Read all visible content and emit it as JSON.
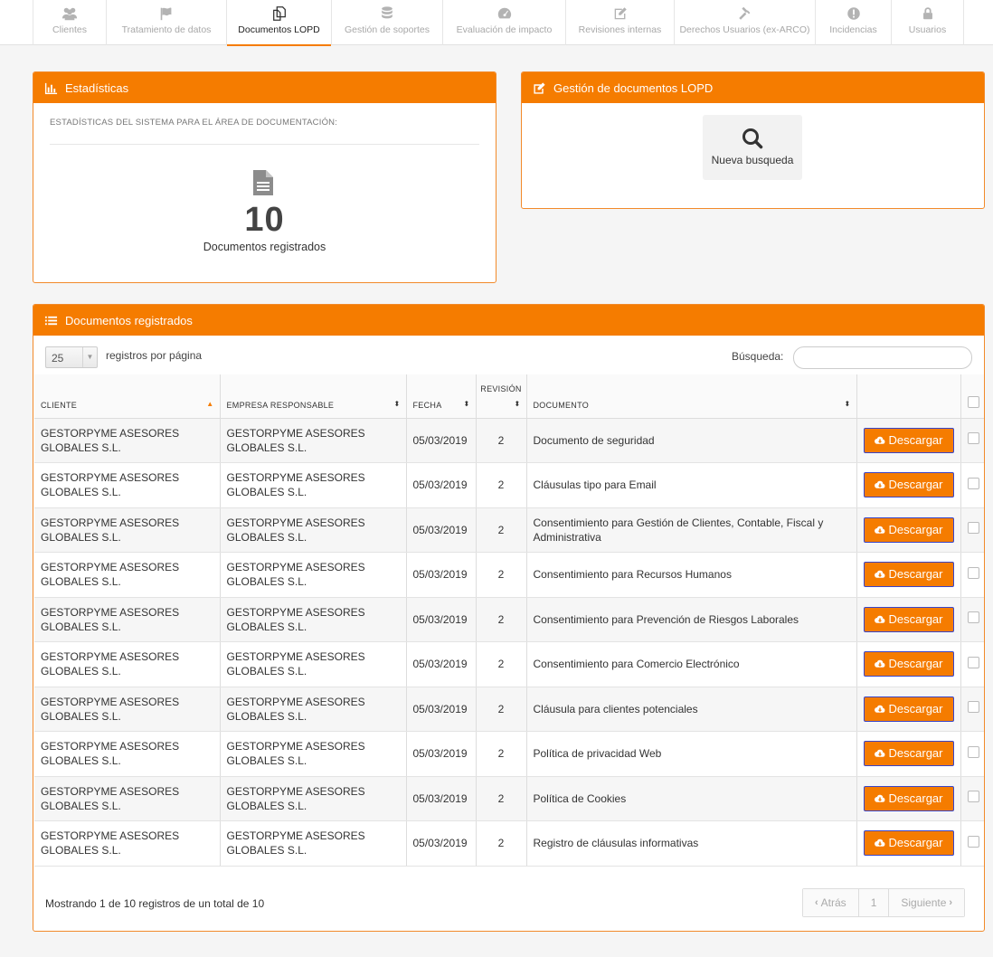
{
  "nav": {
    "tabs": [
      {
        "label": "Clientes",
        "icon": "users-icon"
      },
      {
        "label": "Tratamiento de datos",
        "icon": "flag-icon"
      },
      {
        "label": "Documentos LOPD",
        "icon": "copy-icon"
      },
      {
        "label": "Gestión de soportes",
        "icon": "database-icon"
      },
      {
        "label": "Evaluación de impacto",
        "icon": "dashboard-icon"
      },
      {
        "label": "Revisiones internas",
        "icon": "edit-icon"
      },
      {
        "label": "Derechos Usuarios (ex-ARCO)",
        "icon": "gavel-icon"
      },
      {
        "label": "Incidencias",
        "icon": "alert-icon"
      },
      {
        "label": "Usuarios",
        "icon": "lock-icon"
      }
    ],
    "active_index": 2
  },
  "stats": {
    "title": "Estadísticas",
    "caption": "Estadísticas del sistema para el área de documentación:",
    "count": "10",
    "count_label": "Documentos registrados"
  },
  "manage": {
    "title": "Gestión de documentos LOPD",
    "search_tile_label": "Nueva busqueda"
  },
  "table_panel": {
    "title": "Documentos registrados",
    "page_size": "25",
    "page_size_label": "registros por página",
    "search_label": "Búsqueda:",
    "search_value": "",
    "headers": {
      "cliente": "Cliente",
      "empresa": "Empresa responsable",
      "fecha": "Fecha",
      "revision": "Revisión",
      "documento": "Documento"
    },
    "download_label": "Descargar",
    "rows": [
      {
        "cliente": "GESTORPYME ASESORES GLOBALES S.L.",
        "empresa": "GESTORPYME ASESORES GLOBALES S.L.",
        "fecha": "05/03/2019",
        "revision": "2",
        "documento": "Documento de seguridad"
      },
      {
        "cliente": "GESTORPYME ASESORES GLOBALES S.L.",
        "empresa": "GESTORPYME ASESORES GLOBALES S.L.",
        "fecha": "05/03/2019",
        "revision": "2",
        "documento": "Cláusulas tipo para Email"
      },
      {
        "cliente": "GESTORPYME ASESORES GLOBALES S.L.",
        "empresa": "GESTORPYME ASESORES GLOBALES S.L.",
        "fecha": "05/03/2019",
        "revision": "2",
        "documento": "Consentimiento para Gestión de Clientes, Contable, Fiscal y Administrativa"
      },
      {
        "cliente": "GESTORPYME ASESORES GLOBALES S.L.",
        "empresa": "GESTORPYME ASESORES GLOBALES S.L.",
        "fecha": "05/03/2019",
        "revision": "2",
        "documento": "Consentimiento para Recursos Humanos"
      },
      {
        "cliente": "GESTORPYME ASESORES GLOBALES S.L.",
        "empresa": "GESTORPYME ASESORES GLOBALES S.L.",
        "fecha": "05/03/2019",
        "revision": "2",
        "documento": "Consentimiento para Prevención de Riesgos Laborales"
      },
      {
        "cliente": "GESTORPYME ASESORES GLOBALES S.L.",
        "empresa": "GESTORPYME ASESORES GLOBALES S.L.",
        "fecha": "05/03/2019",
        "revision": "2",
        "documento": "Consentimiento para Comercio Electrónico"
      },
      {
        "cliente": "GESTORPYME ASESORES GLOBALES S.L.",
        "empresa": "GESTORPYME ASESORES GLOBALES S.L.",
        "fecha": "05/03/2019",
        "revision": "2",
        "documento": "Cláusula para clientes potenciales"
      },
      {
        "cliente": "GESTORPYME ASESORES GLOBALES S.L.",
        "empresa": "GESTORPYME ASESORES GLOBALES S.L.",
        "fecha": "05/03/2019",
        "revision": "2",
        "documento": "Política de privacidad Web"
      },
      {
        "cliente": "GESTORPYME ASESORES GLOBALES S.L.",
        "empresa": "GESTORPYME ASESORES GLOBALES S.L.",
        "fecha": "05/03/2019",
        "revision": "2",
        "documento": "Política de Cookies"
      },
      {
        "cliente": "GESTORPYME ASESORES GLOBALES S.L.",
        "empresa": "GESTORPYME ASESORES GLOBALES S.L.",
        "fecha": "05/03/2019",
        "revision": "2",
        "documento": "Registro de cláusulas informativas"
      }
    ],
    "footer_info": "Mostrando 1 de 10 registros de un total de 10",
    "pager": {
      "prev": "Atrás",
      "page": "1",
      "next": "Siguiente"
    }
  },
  "colors": {
    "accent": "#f57c00"
  }
}
